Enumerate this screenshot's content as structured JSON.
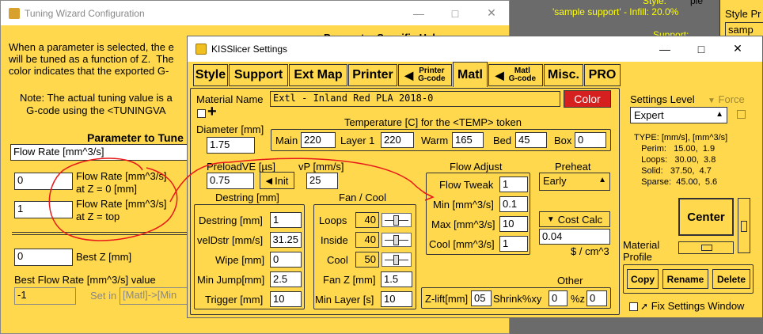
{
  "background": {
    "sample_support": "'sample support' - Infill: 20.0%",
    "style_hint": "Style:",
    "support_hint": "Support:",
    "ple": "ple"
  },
  "right_panel": {
    "label": "Style Pr",
    "value": "samp"
  },
  "tuning_window": {
    "title": "Tuning Wizard Configuration",
    "intro": "When a parameter is selected, the e\nwill be tuned as a function of Z.  The\ncolor indicates that the exported G-",
    "param_help": "Parameter Specific Help",
    "note": "Note: The actual tuning value is a\nG-code using the <TUNINGVA",
    "param_heading": "Parameter to Tune",
    "param_value": "Flow Rate [mm^3/s]",
    "z0_value": "0",
    "z0_label": "Flow Rate [mm^3/s]\nat Z = 0 [mm]",
    "ztop_value": "1",
    "ztop_label": "Flow Rate [mm^3/s]\nat Z = top",
    "bestz_value": "0",
    "bestz_label": "Best Z [mm]",
    "best_flow_label": "Best Flow Rate [mm^3/s] value",
    "best_flow_value": "-1",
    "set_in_label": "Set in",
    "set_in_value": "[Matl]->[Min"
  },
  "kiss_window": {
    "title": "KISSlicer Settings",
    "tabs": [
      "Style",
      "Support",
      "Ext Map",
      "Printer",
      "Printer\nG-code",
      "Matl",
      "Matl\nG-code",
      "Misc.",
      "PRO"
    ],
    "material_name_label": "Material Name",
    "material_name_value": "Extl - Inland Red PLA               2018-0",
    "color_button": "Color",
    "diameter_label": "Diameter [mm]",
    "diameter_value": "1.75",
    "temp_heading": "Temperature [C] for the <TEMP> token",
    "temp": {
      "main_label": "Main",
      "main_value": "220",
      "layer1_label": "Layer 1",
      "layer1_value": "220",
      "warm_label": "Warm",
      "warm_value": "165",
      "bed_label": "Bed",
      "bed_value": "45",
      "box_label": "Box",
      "box_value": "0"
    },
    "preload_label": "PreloadVE [µs]",
    "preload_value": "0.75",
    "init_button": "Init",
    "vp_label": "vP [mm/s]",
    "vp_value": "25",
    "flow_adjust": {
      "heading": "Flow Adjust",
      "tweak_label": "Flow Tweak",
      "tweak_value": "1",
      "min_label": "Min [mm^3/s]",
      "min_value": "0.1",
      "max_label": "Max [mm^3/s]",
      "max_value": "10",
      "cool_label": "Cool [mm^3/s]",
      "cool_value": "1"
    },
    "preheat": {
      "heading": "Preheat",
      "value": "Early"
    },
    "cost_calc_button": "Cost Calc",
    "cost_value": "0.04",
    "cost_unit": "$ / cm^3",
    "destring": {
      "heading": "Destring [mm]",
      "destring_label": "Destring [mm]",
      "destring_value": "1",
      "veldstr_label": "velDstr [mm/s]",
      "veldstr_value": "31.25",
      "wipe_label": "Wipe [mm]",
      "wipe_value": "0",
      "minjump_label": "Min Jump[mm]",
      "minjump_value": "2.5",
      "trigger_label": "Trigger [mm]",
      "trigger_value": "10"
    },
    "fan": {
      "heading": "Fan / Cool",
      "loops_label": "Loops",
      "loops_value": "40",
      "inside_label": "Inside",
      "inside_value": "40",
      "cool_label": "Cool",
      "cool_value": "50",
      "fanz_label": "Fan Z [mm]",
      "fanz_value": "1.5",
      "minlayer_label": "Min Layer [s]",
      "minlayer_value": "10"
    },
    "other": {
      "heading": "Other",
      "zlift_label": "Z-lift[mm]",
      "zlift_value": "05",
      "shrink_label": "Shrink%xy",
      "shrink_value": "0",
      "shrinkz_label": "%z",
      "shrinkz_value": "0"
    },
    "settings_level_label": "Settings Level",
    "force_label": "Force",
    "settings_level_value": "Expert",
    "type_info": "TYPE: [mm/s], [mm^3/s]\n   Perim:   15.00,  1.9\n   Loops:   30.00,  3.8\n   Solid:   37.50,  4.7\n   Sparse:  45.00,  5.6",
    "center_button": "Center",
    "material_profile_label": "Material\nProfile",
    "copy_button": "Copy",
    "rename_button": "Rename",
    "delete_button": "Delete",
    "fix_settings_label": "Fix Settings Window"
  },
  "colors": {
    "panel": "#ffd84e",
    "color_button": "#d62020",
    "annotation": "#e81818"
  }
}
